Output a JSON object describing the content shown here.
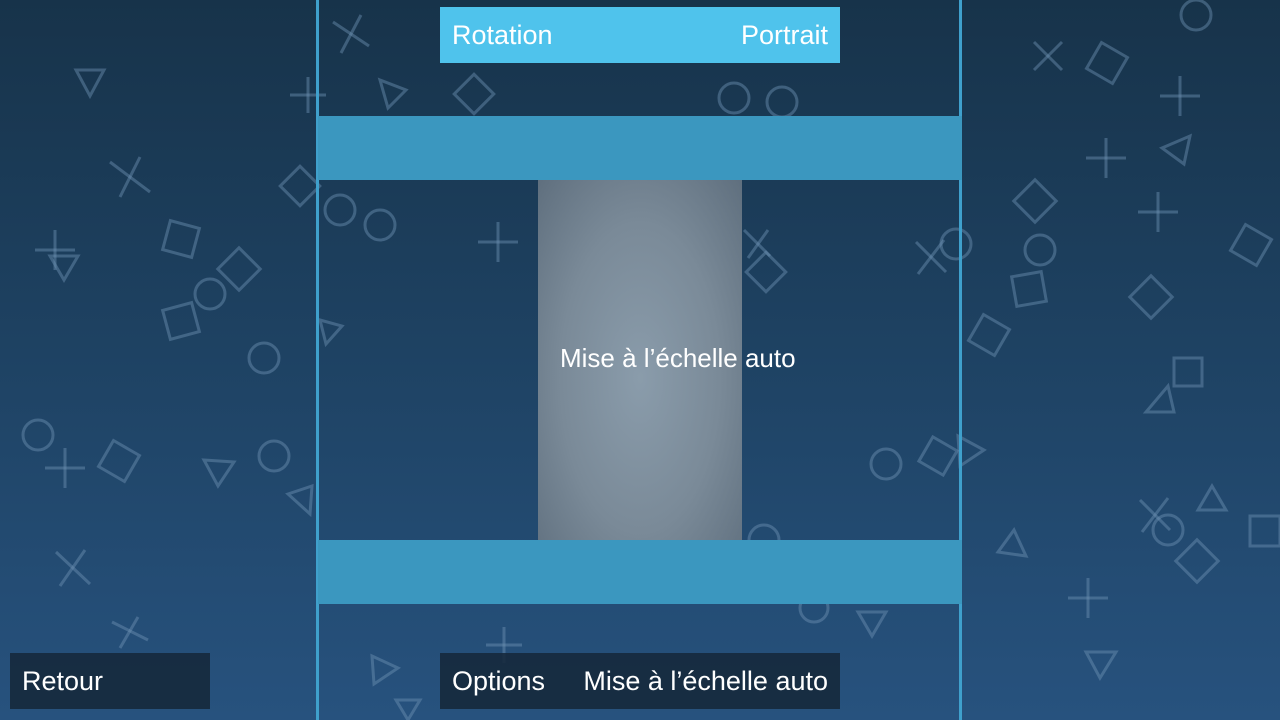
{
  "colors": {
    "accent": "#4fc3ec",
    "band": "#3b97bf",
    "frame": "#3fa0cc",
    "background_top": "#17334a",
    "background_bottom": "#27527e"
  },
  "background": {
    "icons": [
      "cross-icon",
      "circle-icon",
      "square-icon",
      "triangle-icon"
    ]
  },
  "rotation_row": {
    "label": "Rotation",
    "value": "Portrait"
  },
  "preview": {
    "label": "Mise à l’échelle auto"
  },
  "options_row": {
    "label": "Options",
    "value": "Mise à l’échelle auto"
  },
  "back_button": {
    "label": "Retour"
  }
}
